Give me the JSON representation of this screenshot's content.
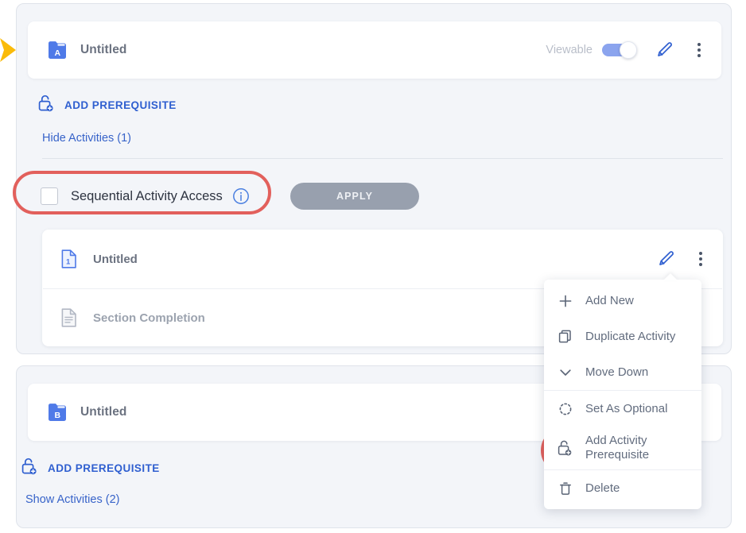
{
  "sections": [
    {
      "id": "a",
      "badge_letter": "A",
      "title": "Untitled",
      "viewable_label": "Viewable",
      "viewable_on": true,
      "add_prerequisite_label": "ADD PREREQUISITE",
      "activities_toggle_label": "Hide Activities (1)",
      "sequential_access": {
        "label": "Sequential Activity Access",
        "checked": false,
        "info_icon": "info-circle-icon",
        "apply_label": "APPLY",
        "apply_enabled": false
      },
      "activity": {
        "badge_number": "1",
        "title": "Untitled",
        "sub_row_title": "Section Completion"
      }
    },
    {
      "id": "b",
      "badge_letter": "B",
      "title": "Untitled",
      "add_prerequisite_label": "ADD PREREQUISITE",
      "activities_toggle_label": "Show Activities (2)"
    }
  ],
  "context_menu": {
    "items": [
      {
        "label": "Add New",
        "icon": "plus-icon"
      },
      {
        "label": "Duplicate Activity",
        "icon": "duplicate-icon"
      },
      {
        "label": "Move Down",
        "icon": "chevron-down-icon"
      },
      {
        "label": "Set As Optional",
        "icon": "dotted-circle-icon"
      },
      {
        "label": "Add Activity Prerequisite",
        "icon": "lock-plus-icon"
      },
      {
        "label": "Delete",
        "icon": "trash-icon"
      }
    ]
  },
  "highlights": {
    "ring_color": "#e2605c",
    "targets": [
      "sequential-activity-access",
      "add-activity-prerequisite-menu-item"
    ]
  },
  "markers": {
    "pointer_arrow_color": "#fabb0a"
  },
  "colors": {
    "accent_blue": "#3763c9",
    "folder_blue": "#4f7ae8",
    "toggle_on": "#8ba4ee",
    "page_bg": "#ffffff",
    "card_bg": "#f3f5f9",
    "row_bg": "#ffffff",
    "apply_disabled": "#98a0ae"
  }
}
